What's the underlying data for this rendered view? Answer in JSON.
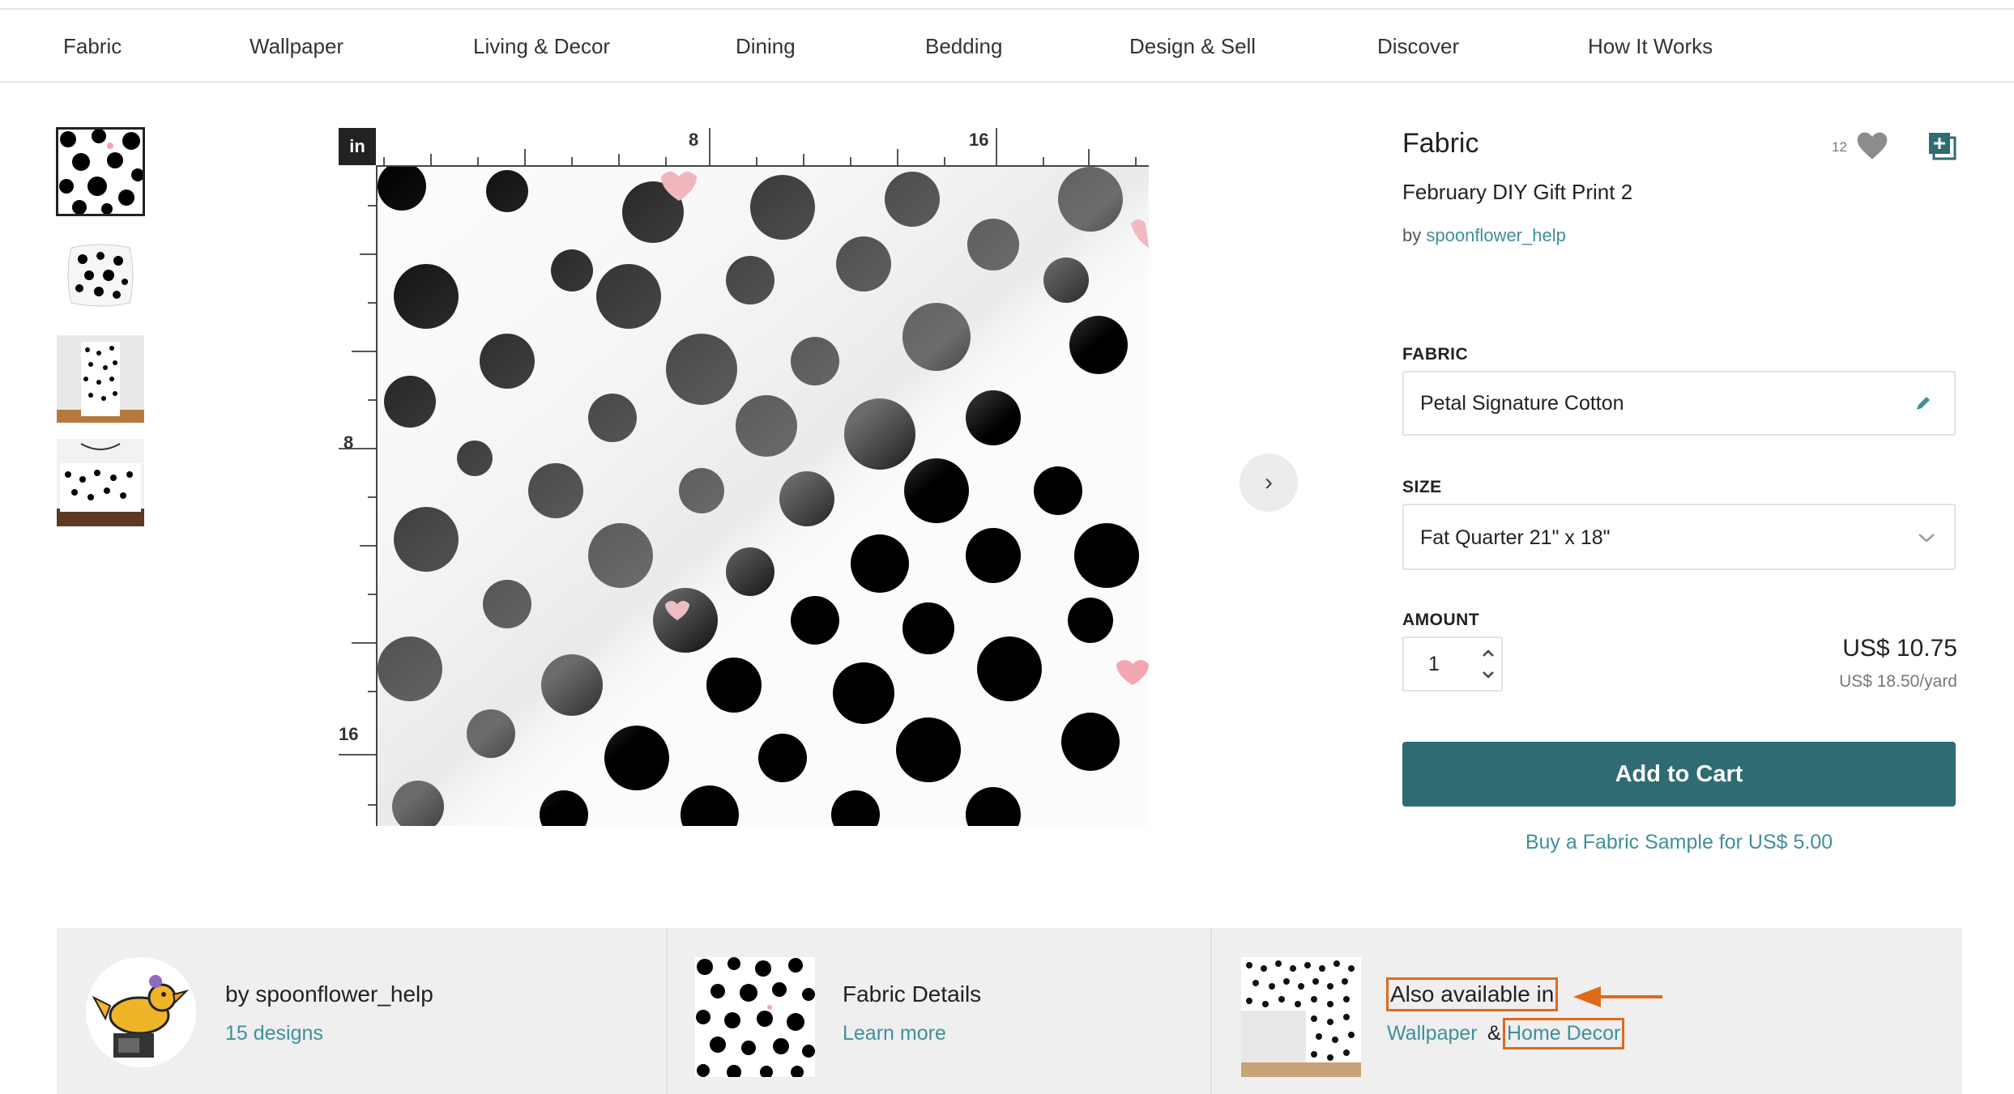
{
  "nav": {
    "items": [
      "Fabric",
      "Wallpaper",
      "Living & Decor",
      "Dining",
      "Bedding",
      "Design & Sell",
      "Discover",
      "How It Works"
    ]
  },
  "viewer": {
    "unit": "in",
    "ruler_top": [
      "8",
      "16"
    ],
    "ruler_left": [
      "8",
      "16"
    ],
    "next_icon": "chevron-right-icon"
  },
  "product": {
    "type": "Fabric",
    "name": "February DIY Gift Print 2",
    "by_prefix": "by",
    "designer": "spoonflower_help",
    "favorites": "12",
    "fabric_label": "FABRIC",
    "fabric_value": "Petal Signature Cotton",
    "size_label": "SIZE",
    "size_value": "Fat Quarter 21\" x 18\"",
    "amount_label": "AMOUNT",
    "amount_value": "1",
    "price": "US$ 10.75",
    "unit_price": "US$ 18.50/yard",
    "add_to_cart": "Add to Cart",
    "sample_link": "Buy a Fabric Sample for US$ 5.00"
  },
  "info": {
    "designer_title": "by spoonflower_help",
    "designer_link": "15 designs",
    "details_title": "Fabric Details",
    "details_link": "Learn more",
    "also_title": "Also available in",
    "also_link1": "Wallpaper",
    "also_amp": "&",
    "also_link2": "Home Decor"
  },
  "colors": {
    "accent": "#2e6b72",
    "link": "#3f8f9a",
    "annotation": "#e06a1b"
  }
}
